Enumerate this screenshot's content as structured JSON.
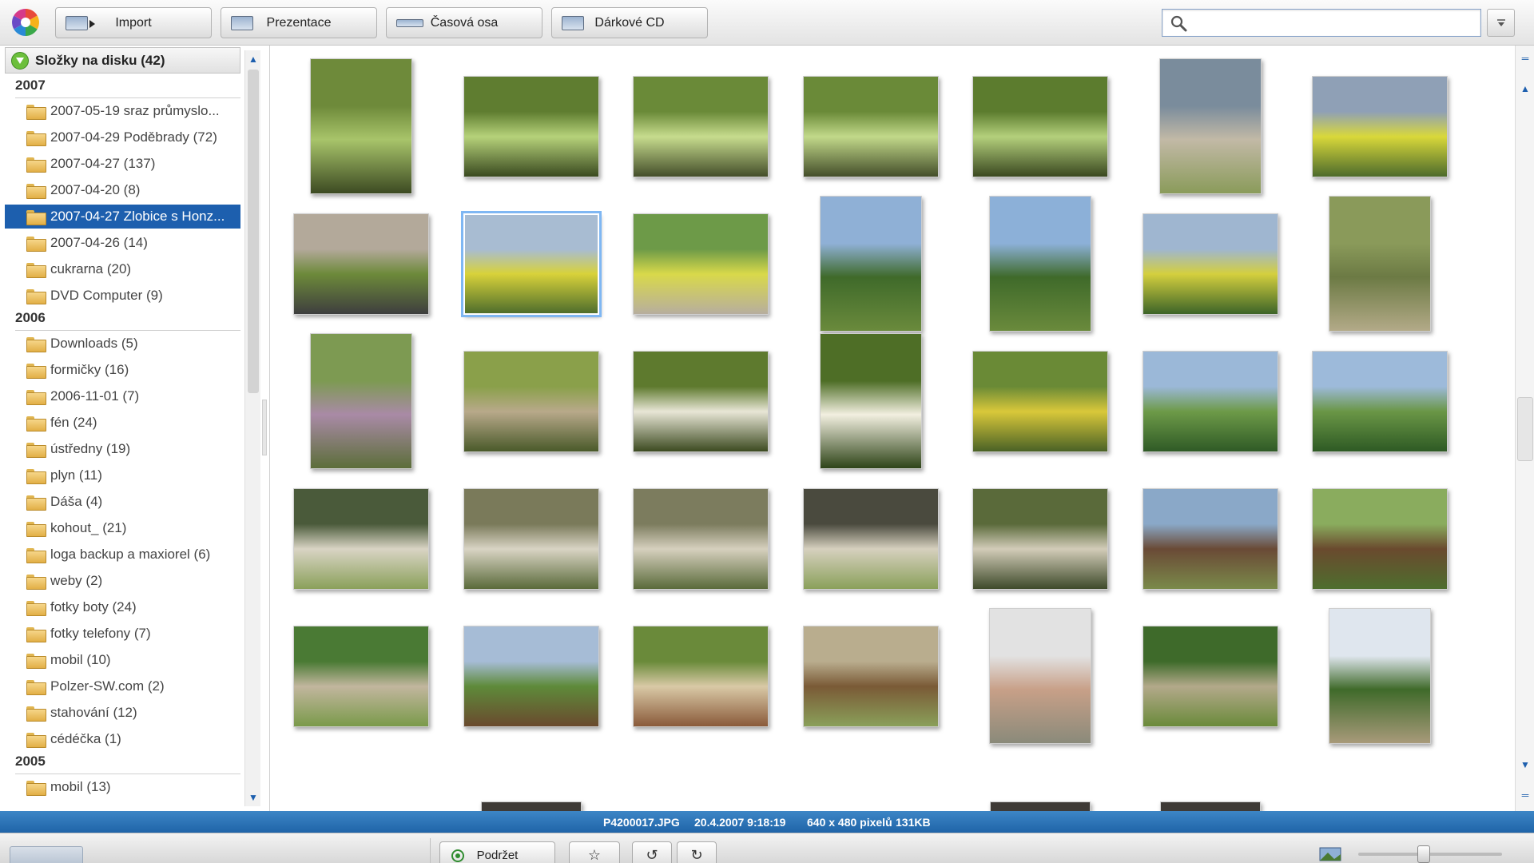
{
  "toolbar": {
    "buttons": [
      {
        "label": "Import",
        "icon": "camera-import-icon"
      },
      {
        "label": "Prezentace",
        "icon": "slideshow-icon"
      },
      {
        "label": "Časová osa",
        "icon": "timeline-icon"
      },
      {
        "label": "Dárkové CD",
        "icon": "gift-cd-icon"
      }
    ],
    "search": {
      "value": "",
      "placeholder": ""
    }
  },
  "sidebar": {
    "header": "Složky na disku (42)",
    "groups": [
      {
        "year": "2007",
        "folders": [
          {
            "label": "2007-05-19 sraz průmyslo..."
          },
          {
            "label": "2007-04-29 Poděbrady (72)"
          },
          {
            "label": "2007-04-27 (137)"
          },
          {
            "label": "2007-04-20 (8)"
          },
          {
            "label": "2007-04-27 Zlobice s Honz...",
            "selected": true
          },
          {
            "label": "2007-04-26 (14)"
          },
          {
            "label": "cukrarna (20)"
          },
          {
            "label": "DVD Computer (9)"
          }
        ]
      },
      {
        "year": "2006",
        "folders": [
          {
            "label": "Downloads (5)"
          },
          {
            "label": "formičky (16)"
          },
          {
            "label": "2006-11-01 (7)"
          },
          {
            "label": "fén (24)"
          },
          {
            "label": "ústředny (19)"
          },
          {
            "label": "plyn (11)"
          },
          {
            "label": "Dáša (4)"
          },
          {
            "label": "kohout_ (21)"
          },
          {
            "label": "loga backup a maxiorel (6)"
          },
          {
            "label": "weby (2)"
          },
          {
            "label": "fotky boty (24)"
          },
          {
            "label": "fotky telefony (7)"
          },
          {
            "label": "mobil (10)"
          },
          {
            "label": "Polzer-SW.com (2)"
          },
          {
            "label": "stahování (12)"
          },
          {
            "label": "cédéčka (1)"
          }
        ]
      },
      {
        "year": "2005",
        "folders": [
          {
            "label": "mobil (13)"
          }
        ]
      }
    ]
  },
  "photos": {
    "selected_index": 8,
    "items": [
      {
        "desc": "man by tree roots on path",
        "orient": "portrait",
        "colors": [
          "#6e8a3a",
          "#a8c46a",
          "#3c4a22"
        ]
      },
      {
        "desc": "man by trees",
        "orient": "landscape",
        "colors": [
          "#5f7d30",
          "#b6d27a",
          "#3a4a20"
        ]
      },
      {
        "desc": "man rotated in forest",
        "orient": "landscape",
        "colors": [
          "#6a8a38",
          "#c7dc8e",
          "#444e2a"
        ]
      },
      {
        "desc": "man rotated in forest",
        "orient": "landscape",
        "colors": [
          "#6a8a38",
          "#c2d98a",
          "#444e2a"
        ]
      },
      {
        "desc": "man between trees",
        "orient": "landscape",
        "colors": [
          "#5c7c2e",
          "#b4d07c",
          "#3a4820"
        ]
      },
      {
        "desc": "man photographing on road",
        "orient": "portrait",
        "colors": [
          "#7a8c9c",
          "#c2b9a6",
          "#8a9b5a"
        ]
      },
      {
        "desc": "rapeseed field",
        "orient": "landscape",
        "colors": [
          "#8fa0b6",
          "#d9d83a",
          "#4d6b2c"
        ]
      },
      {
        "desc": "man lying on gravel",
        "orient": "landscape",
        "colors": [
          "#b3a99a",
          "#6d8a3a",
          "#3e3e3e"
        ]
      },
      {
        "desc": "yellow field hills",
        "orient": "landscape",
        "colors": [
          "#a8bcd2",
          "#d8d23a",
          "#4f6e2c"
        ]
      },
      {
        "desc": "man on field path",
        "orient": "landscape",
        "colors": [
          "#6d9a48",
          "#d9d94a",
          "#b7ae9e"
        ]
      },
      {
        "desc": "tree against sky",
        "orient": "portrait",
        "colors": [
          "#8fb0d6",
          "#3f6a2a",
          "#6a8a3c"
        ]
      },
      {
        "desc": "tree against sky",
        "orient": "portrait",
        "colors": [
          "#8cb0d8",
          "#3f6a2a",
          "#6a8a3c"
        ]
      },
      {
        "desc": "hill with yellow field",
        "orient": "landscape",
        "colors": [
          "#9fb6d0",
          "#d4cf3e",
          "#3c6428"
        ]
      },
      {
        "desc": "grass close-up",
        "orient": "portrait",
        "colors": [
          "#8a9a5a",
          "#6c7a44",
          "#b3aa88"
        ]
      },
      {
        "desc": "grass and flowers",
        "orient": "portrait",
        "colors": [
          "#7d9a52",
          "#a98aa6",
          "#5c6e3a"
        ]
      },
      {
        "desc": "man on slope",
        "orient": "landscape",
        "colors": [
          "#8aa04a",
          "#b8a98a",
          "#4a5a2a"
        ]
      },
      {
        "desc": "white flowers",
        "orient": "landscape",
        "colors": [
          "#5e7a2e",
          "#e8e6d6",
          "#3c4a20"
        ]
      },
      {
        "desc": "white flower close-up",
        "orient": "portrait",
        "colors": [
          "#4e6e26",
          "#f2efe0",
          "#2e4418"
        ]
      },
      {
        "desc": "yellow wildflowers",
        "orient": "landscape",
        "colors": [
          "#6a8a36",
          "#d9c83a",
          "#4a6226"
        ]
      },
      {
        "desc": "meadow and trees",
        "orient": "landscape",
        "colors": [
          "#9bb8d8",
          "#6d9a48",
          "#2f5a26"
        ]
      },
      {
        "desc": "meadow and trees",
        "orient": "landscape",
        "colors": [
          "#9dbada",
          "#6a9646",
          "#2e5a24"
        ]
      },
      {
        "desc": "sheep near barn",
        "orient": "landscape",
        "colors": [
          "#4a5a3a",
          "#d9d4c4",
          "#8aa05a"
        ]
      },
      {
        "desc": "sheep under vehicle",
        "orient": "landscape",
        "colors": [
          "#7a7a5a",
          "#d9d4c4",
          "#5a6a3a"
        ]
      },
      {
        "desc": "sheep under vehicle",
        "orient": "landscape",
        "colors": [
          "#7c7c5e",
          "#d6d0be",
          "#5a6a3a"
        ]
      },
      {
        "desc": "sheep grazing",
        "orient": "landscape",
        "colors": [
          "#4a4a3e",
          "#d6d0be",
          "#8aa05a"
        ]
      },
      {
        "desc": "sheep flock",
        "orient": "landscape",
        "colors": [
          "#5a6a3a",
          "#d2ccb8",
          "#3e4a2a"
        ]
      },
      {
        "desc": "sheep by barn",
        "orient": "landscape",
        "colors": [
          "#8aa8c8",
          "#6a4a36",
          "#7a8a4a"
        ]
      },
      {
        "desc": "horse on meadow",
        "orient": "landscape",
        "colors": [
          "#8aac5e",
          "#6a4a2e",
          "#4e6e2e"
        ]
      },
      {
        "desc": "man walking on path",
        "orient": "landscape",
        "colors": [
          "#4a7a34",
          "#c2b69e",
          "#7a9a4a"
        ]
      },
      {
        "desc": "woman with horses",
        "orient": "landscape",
        "colors": [
          "#a6bcd6",
          "#5e8a3a",
          "#6a4a2e"
        ]
      },
      {
        "desc": "horse in paddock",
        "orient": "landscape",
        "colors": [
          "#6a8a3a",
          "#d9c9a6",
          "#8a5a3a"
        ]
      },
      {
        "desc": "horse in paddock",
        "orient": "landscape",
        "colors": [
          "#b9ad8e",
          "#7a5a36",
          "#8aa05a"
        ]
      },
      {
        "desc": "portrait of man",
        "orient": "portrait",
        "colors": [
          "#e2e2e2",
          "#c8a088",
          "#8a8a7a"
        ]
      },
      {
        "desc": "field edge and trees",
        "orient": "landscape",
        "colors": [
          "#3e6a2a",
          "#b3a98a",
          "#6a8a3a"
        ]
      },
      {
        "desc": "trees and field",
        "orient": "portrait",
        "colors": [
          "#dfe6ee",
          "#3f6a2a",
          "#a89a7a"
        ]
      }
    ]
  },
  "status": {
    "filename": "P4200017.JPG",
    "datetime": "20.4.2007 9:18:19",
    "dimensions": "640 x 480 pixelů",
    "size": "131KB"
  },
  "bottom": {
    "hold_label": "Podržet",
    "zoom_level": 0.45
  },
  "colors": {
    "selection": "#1d5fae",
    "status_bar": "#2a72b6"
  }
}
